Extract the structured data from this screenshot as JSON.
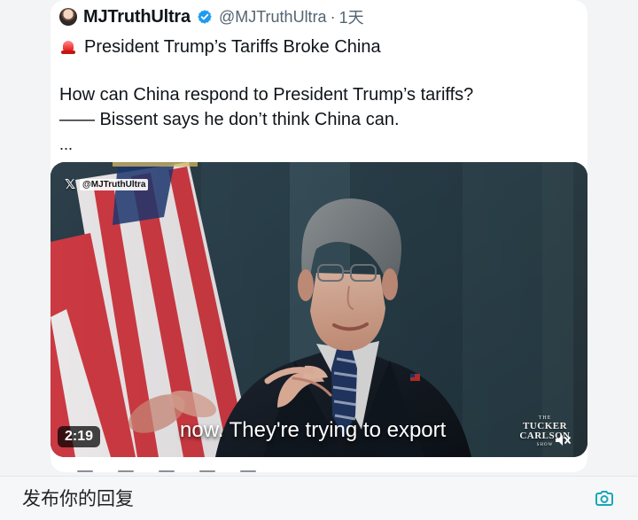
{
  "tweet": {
    "display_name": "MJTruthUltra",
    "handle": "@MJTruthUltra",
    "separator": "·",
    "time": "1天",
    "title": "President Trump’s Tariffs Broke China",
    "body_line_1": "How can China respond to President Trump’s tariffs?",
    "body_line_2": "—— Bissent says he don’t think China can.",
    "ellipsis": "..."
  },
  "video": {
    "watermark": "@MJTruthUltra",
    "caption": "now. They're trying to export",
    "duration": "2:19",
    "logo_the": "THE",
    "logo_main": "TUCKER\nCARLSON",
    "logo_sub": "SHOW"
  },
  "reply": {
    "placeholder": "发布你的回复"
  },
  "icons": {
    "avatar": "avatar",
    "verified": "verified-icon",
    "siren": "siren-icon",
    "x_logo": "x-logo-icon",
    "mute": "mute-icon",
    "camera": "camera-icon"
  },
  "colors": {
    "verified_blue": "#1d9bf0",
    "handle_gray": "#536471",
    "text_primary": "#0f1419",
    "reply_camera": "#18a7b8"
  }
}
